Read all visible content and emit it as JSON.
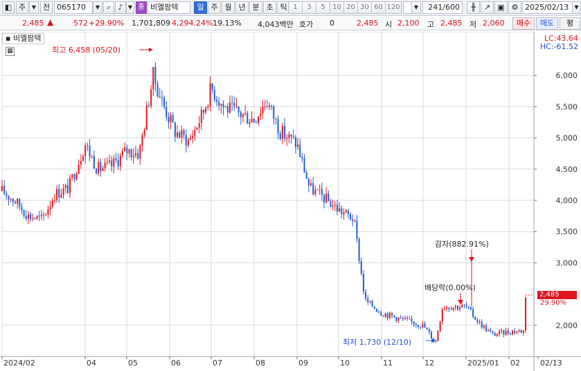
{
  "toolbar": {
    "market_label": "주",
    "prev_label": "전",
    "stock_code": "065170",
    "stock_name": "비엘팜텍",
    "stock_badge": "종",
    "periods": [
      "일",
      "주",
      "월",
      "년",
      "분",
      "초",
      "틱"
    ],
    "active_period": "일",
    "intervals": [
      "1",
      "3",
      "5",
      "10",
      "20",
      "30",
      "60",
      "120"
    ],
    "bar_count": "241/600",
    "date": "2025/02/13"
  },
  "quote": {
    "price": "2,485",
    "change": "572",
    "change_pct": "+29.90%",
    "volume": "1,701,809",
    "volume_pct": "4,294.24%",
    "turnover": "19.13%",
    "amount": "4,043백만",
    "hoga_label": "호가",
    "hoga_value": "0",
    "last": "2,485",
    "open_label": "시",
    "open": "2,100",
    "high_label": "고",
    "high": "2,485",
    "low_label": "저",
    "low": "2,060",
    "buy_label": "매수",
    "sell_label": "매도",
    "eval_label": "평"
  },
  "chart": {
    "legend": "비엘팜텍",
    "lc": "LC:43.64",
    "hc": "HC:-61.52",
    "annotations": {
      "high": "최고 6,458 (05/20)",
      "low": "최저 1,730 (12/10)",
      "capital_reduction": "감자(882.91%)",
      "dividend": "배당락(0.00%)"
    },
    "last_price_tag": "2,485",
    "last_pct_tag": "29.90%",
    "colors": {
      "up": "#e0141e",
      "down": "#1f5bd1",
      "grid": "#d5d9e0"
    }
  },
  "chart_data": {
    "type": "candlestick",
    "title": "",
    "xlabel": "",
    "ylabel": "",
    "ylim": [
      1500,
      6500
    ],
    "y_ticks": [
      "6,000",
      "5,500",
      "5,000",
      "4,500",
      "4,000",
      "3,500",
      "3,000",
      "2,000"
    ],
    "y_tick_values": [
      6000,
      5500,
      5000,
      4500,
      4000,
      3500,
      3000,
      2000
    ],
    "x_ticks": [
      "2024/02",
      "04",
      "05",
      "06",
      "07",
      "08",
      "09",
      "10",
      "11",
      "12",
      "2025/01",
      "02",
      "02/13"
    ],
    "x_tick_dates": [
      "2024-02-01",
      "2024-04-01",
      "2024-05-01",
      "2024-06-01",
      "2024-07-01",
      "2024-08-01",
      "2024-09-01",
      "2024-10-01",
      "2024-11-01",
      "2024-12-01",
      "2025-01-01",
      "2025-02-01",
      "2025-02-13"
    ],
    "range": [
      "2024-02-01",
      "2025-02-13"
    ],
    "series": [
      {
        "points": [
          [
            "2024-02-01",
            4150
          ],
          [
            "2024-02-10",
            4000
          ],
          [
            "2024-02-20",
            3750
          ],
          [
            "2024-03-01",
            3700
          ],
          [
            "2024-03-10",
            4100
          ],
          [
            "2024-03-20",
            4200
          ],
          [
            "2024-04-01",
            4900
          ],
          [
            "2024-04-10",
            4500
          ],
          [
            "2024-04-20",
            4550
          ],
          [
            "2024-05-01",
            4800
          ],
          [
            "2024-05-10",
            4750
          ],
          [
            "2024-05-20",
            6000
          ],
          [
            "2024-05-28",
            5500
          ],
          [
            "2024-06-05",
            5100
          ],
          [
            "2024-06-15",
            4950
          ],
          [
            "2024-06-25",
            5400
          ],
          [
            "2024-07-01",
            5800
          ],
          [
            "2024-07-10",
            5500
          ],
          [
            "2024-07-20",
            5400
          ],
          [
            "2024-08-01",
            5300
          ],
          [
            "2024-08-10",
            5600
          ],
          [
            "2024-08-20",
            5100
          ],
          [
            "2024-09-01",
            4900
          ],
          [
            "2024-09-10",
            4200
          ],
          [
            "2024-09-20",
            4050
          ],
          [
            "2024-10-01",
            3850
          ],
          [
            "2024-10-12",
            3700
          ],
          [
            "2024-10-20",
            2400
          ],
          [
            "2024-11-01",
            2200
          ],
          [
            "2024-11-15",
            2100
          ],
          [
            "2024-12-01",
            2000
          ],
          [
            "2024-12-10",
            1730
          ],
          [
            "2024-12-15",
            2300
          ],
          [
            "2025-01-01",
            2300
          ],
          [
            "2025-01-10",
            2050
          ],
          [
            "2025-01-20",
            1850
          ],
          [
            "2025-02-01",
            1900
          ],
          [
            "2025-02-12",
            1913
          ],
          [
            "2025-02-13",
            2485
          ]
        ]
      }
    ]
  }
}
